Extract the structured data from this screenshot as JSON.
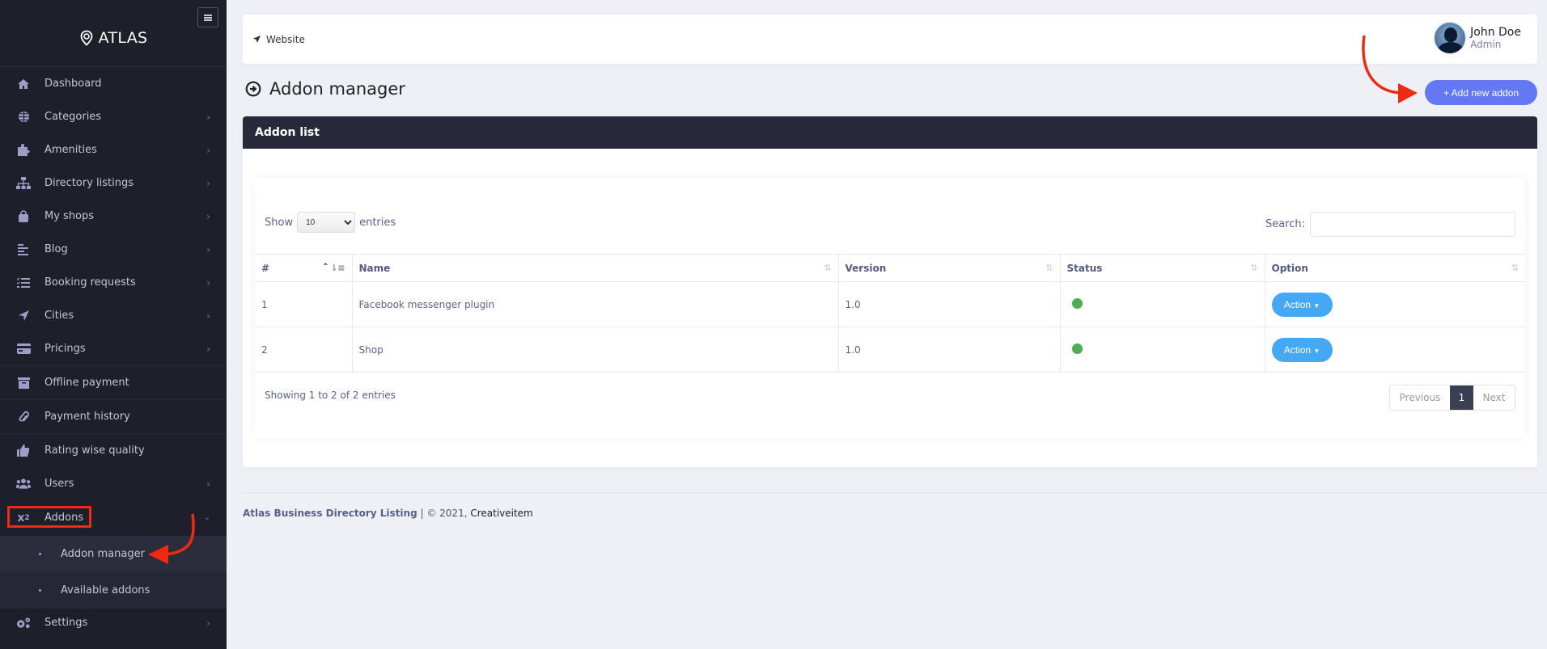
{
  "sidebar": {
    "brand": "ATLAS",
    "toggle_icon": "hamburger-icon",
    "items": [
      {
        "label": "Dashboard",
        "icon": "home-icon",
        "has_children": false
      },
      {
        "label": "Categories",
        "icon": "globe-icon",
        "has_children": true
      },
      {
        "label": "Amenities",
        "icon": "puzzle-icon",
        "has_children": true
      },
      {
        "label": "Directory listings",
        "icon": "sitemap-icon",
        "has_children": true
      },
      {
        "label": "My shops",
        "icon": "shopping-bag-icon",
        "has_children": true
      },
      {
        "label": "Blog",
        "icon": "align-left-icon",
        "has_children": true
      },
      {
        "label": "Booking requests",
        "icon": "tasks-icon",
        "has_children": true
      },
      {
        "label": "Cities",
        "icon": "location-arrow-icon",
        "has_children": true
      },
      {
        "label": "Pricings",
        "icon": "credit-card-icon",
        "has_children": true
      },
      {
        "label": "Offline payment",
        "icon": "archive-icon",
        "has_children": false
      },
      {
        "label": "Payment history",
        "icon": "paperclip-icon",
        "has_children": false
      },
      {
        "label": "Rating wise quality",
        "icon": "thumbs-up-icon",
        "has_children": false
      },
      {
        "label": "Users",
        "icon": "users-icon",
        "has_children": true
      },
      {
        "label": "Addons",
        "icon": "superscript-icon",
        "has_children": true,
        "expanded": true
      },
      {
        "label": "Settings",
        "icon": "cogs-icon",
        "has_children": true
      }
    ],
    "addons_submenu": [
      {
        "label": "Addon manager",
        "active": true
      },
      {
        "label": "Available addons",
        "active": false
      }
    ]
  },
  "topbar": {
    "website_label": "Website",
    "user_name": "John Doe",
    "user_role": "Admin"
  },
  "page": {
    "title": "Addon manager",
    "add_button_label": "+ Add new addon"
  },
  "card": {
    "title": "Addon list",
    "show_label": "Show",
    "entries_label": "entries",
    "page_length": "10",
    "search_label": "Search:",
    "search_value": "",
    "columns": [
      "#",
      "Name",
      "Version",
      "Status",
      "Option"
    ],
    "rows": [
      {
        "index": "1",
        "name": "Facebook messenger plugin",
        "version": "1.0",
        "status": "active",
        "action_label": "Action"
      },
      {
        "index": "2",
        "name": "Shop",
        "version": "1.0",
        "status": "active",
        "action_label": "Action"
      }
    ],
    "info": "Showing 1 to 2 of 2 entries",
    "pagination": {
      "previous": "Previous",
      "current": "1",
      "next": "Next"
    }
  },
  "footer": {
    "product": "Atlas Business Directory Listing",
    "separator": " | © 2021, ",
    "company": "Creativeitem"
  },
  "colors": {
    "sidebar_bg": "#1e1f2b",
    "card_header_bg": "#282a3c",
    "primary_button": "#6378f2",
    "action_button": "#45a8f5",
    "status_active": "#4cae4f",
    "annotation_red": "#ee2b12"
  }
}
